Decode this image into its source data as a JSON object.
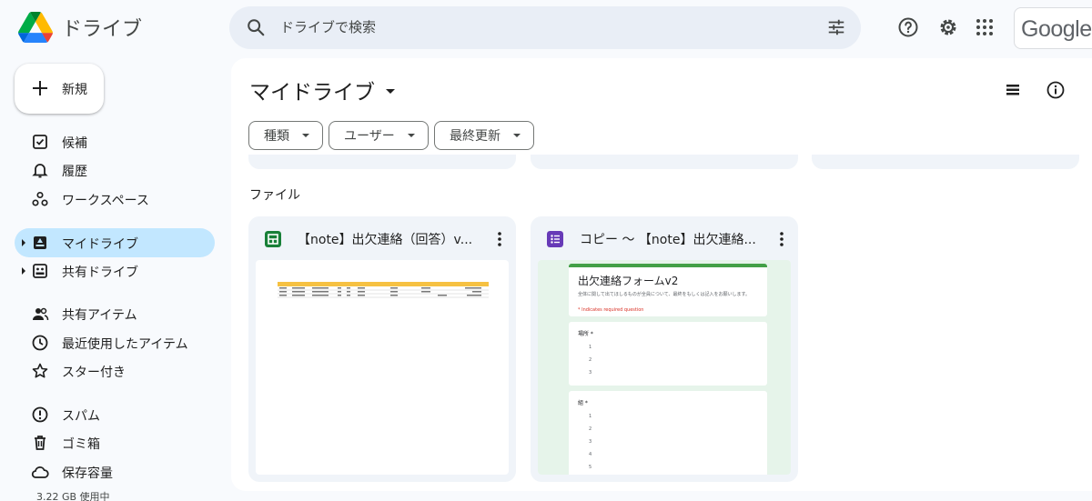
{
  "app": {
    "name": "ドライブ",
    "google_label": "Google"
  },
  "search": {
    "placeholder": "ドライブで検索"
  },
  "sidebar": {
    "new_label": "新規",
    "items": [
      {
        "label": "候補"
      },
      {
        "label": "履歴"
      },
      {
        "label": "ワークスペース"
      },
      {
        "label": "マイドライブ",
        "active": true
      },
      {
        "label": "共有ドライブ"
      },
      {
        "label": "共有アイテム"
      },
      {
        "label": "最近使用したアイテム"
      },
      {
        "label": "スター付き"
      },
      {
        "label": "スパム"
      },
      {
        "label": "ゴミ箱"
      },
      {
        "label": "保存容量"
      }
    ],
    "storage_used": "3.22 GB 使用中"
  },
  "main": {
    "title": "マイドライブ",
    "filters": [
      "種類",
      "ユーザー",
      "最終更新"
    ],
    "section_files": "ファイル",
    "files": [
      {
        "name": "【note】出欠連絡（回答）v...",
        "type": "sheets-icon"
      },
      {
        "name": "コピー ～ 【note】出欠連絡...",
        "type": "forms-icon"
      }
    ],
    "form_preview": {
      "title": "出欠連絡フォームv2",
      "description": "全体に関して出てほしるものが全員について、最終をもしくは記入をお願いします。",
      "required_note": "* Indicates required question",
      "q1": "場所 *",
      "q1_options": [
        "1",
        "2",
        "3"
      ],
      "q2": "組 *",
      "q2_options": [
        "1",
        "2",
        "3",
        "4",
        "5"
      ]
    }
  },
  "colors": {
    "accent": "#c2e7ff",
    "sheets": "#188038",
    "forms": "#673ab7",
    "background": "#f8fafd"
  }
}
